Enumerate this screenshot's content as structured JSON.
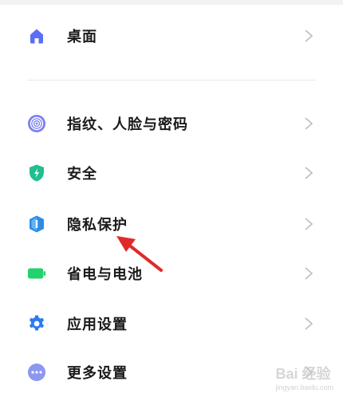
{
  "settings": {
    "items": [
      {
        "label": "桌面",
        "icon": "home-icon",
        "color": "#5b6ef5"
      },
      {
        "label": "指纹、人脸与密码",
        "icon": "fingerprint-icon",
        "color": "#7b7ff0"
      },
      {
        "label": "安全",
        "icon": "shield-icon",
        "color": "#1fbf8f"
      },
      {
        "label": "隐私保护",
        "icon": "privacy-icon",
        "color": "#2b8de6"
      },
      {
        "label": "省电与电池",
        "icon": "battery-icon",
        "color": "#22d36b"
      },
      {
        "label": "应用设置",
        "icon": "gear-icon",
        "color": "#2b7cf0"
      },
      {
        "label": "更多设置",
        "icon": "more-icon",
        "color": "#8b97f0"
      }
    ]
  },
  "annotation": {
    "color": "#e02a2a"
  },
  "watermark": {
    "brand": "Bai  经验",
    "sub": "jingyan.baidu.com"
  }
}
